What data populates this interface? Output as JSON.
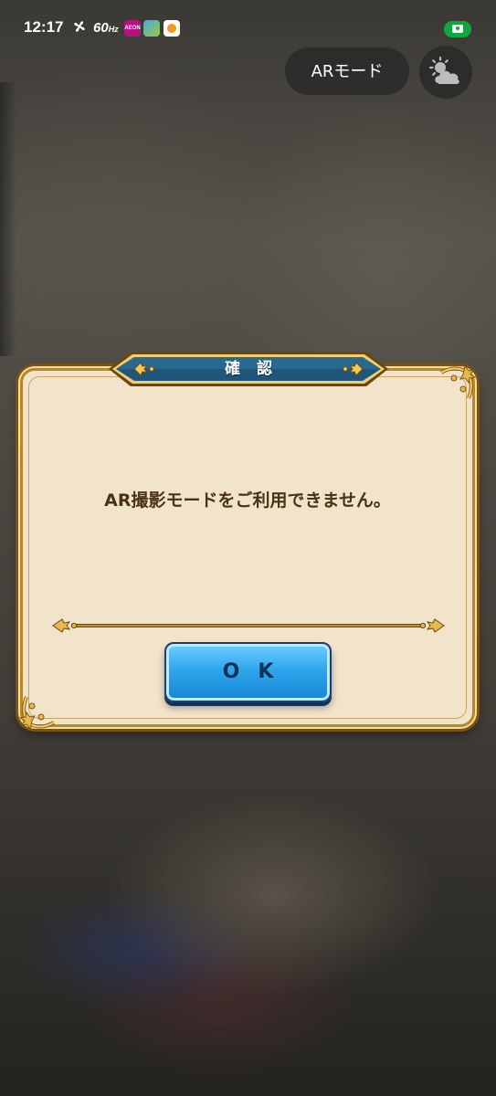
{
  "status_bar": {
    "time": "12:17",
    "refresh_rate": "60",
    "refresh_rate_unit": "Hz",
    "app_icons": [
      "aeon-pay-icon",
      "game-app-icon",
      "orange-app-icon"
    ],
    "camera_indicator_color": "#12a640"
  },
  "top_controls": {
    "ar_mode_label": "ARモード",
    "weather_icon": "partly-cloudy-icon"
  },
  "dialog": {
    "title": "確認",
    "message": "AR撮影モードをご利用できません。",
    "ok_label": "OK",
    "colors": {
      "panel": "#f2e4cb",
      "frame_gold": "#b8862b",
      "banner_blue": "#1f5679",
      "button_blue": "#2fa7ec",
      "message_text": "#4a3214"
    }
  }
}
